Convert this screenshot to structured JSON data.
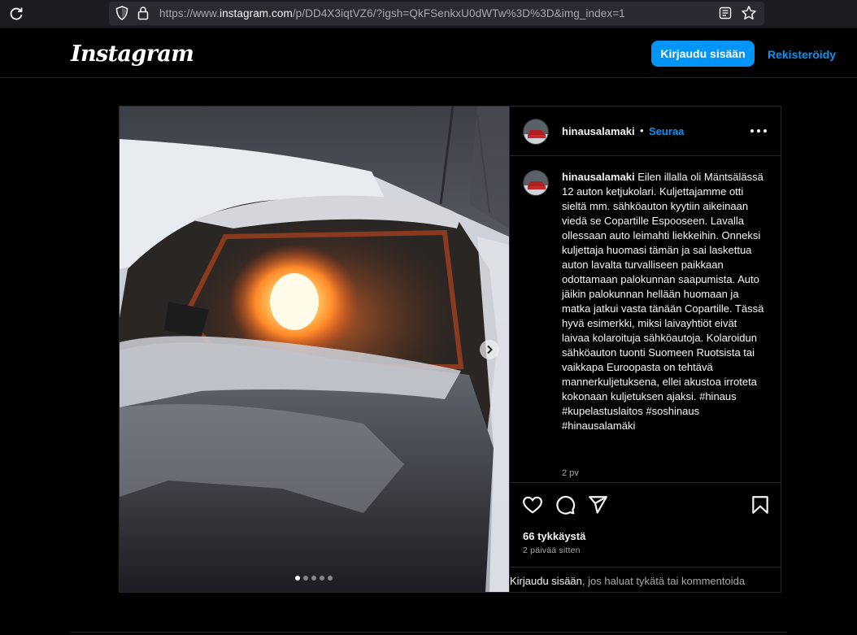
{
  "browser": {
    "url_prefix": "https://www.",
    "url_domain": "instagram.com",
    "url_path": "/p/DD4X3iqtVZ6/?igsh=QkFSenkxU0dWTw%3D%3D&img_index=1"
  },
  "header": {
    "logo": "Instagram",
    "login_label": "Kirjaudu sisään",
    "signup_label": "Rekisteröidy"
  },
  "post": {
    "username": "hinausalamaki",
    "separator": "•",
    "follow_label": "Seuraa",
    "caption_user": "hinausalamaki",
    "caption_text": "Eilen illalla oli Mäntsälässä 12 auton ketjukolari. Kuljettajamme otti sieltä mm. sähköauton kyytiin aikeinaan viedä se Copartille Espooseen. Lavalla ollessaan auto leimahti liekkeihin. Onneksi kuljettaja huomasi tämän ja sai laskettua auton lavalta turvalliseen paikkaan odottamaan palokunnan saapumista. Auto jäikin palokunnan hellään huomaan ja matka jatkui vasta tänään Copartille. Tässä hyvä esimerkki, miksi laivayhtiöt eivät laivaa kolaroituja sähköautoja. Kolaroidun sähköauton tuonti Suomeen Ruotsista tai vaikkapa Euroopasta on tehtävä mannerkuljetuksena, ellei akustoa irroteta kokonaan kuljetuksen ajaksi. #hinaus #kupelastuslaitos #soshinaus #hinausalamäki",
    "caption_time": "2 pv",
    "likes": "66 tykkäystä",
    "posted": "2 päivää sitten",
    "login_prompt_link": "Kirjaudu sisään",
    "login_prompt_rest": ", jos haluat tykätä tai kommentoida",
    "carousel_count": 5,
    "carousel_active": 1
  },
  "icons": [
    "reload-icon",
    "shield-icon",
    "lock-icon",
    "reader-view-icon",
    "bookmark-star-icon",
    "more-options-icon",
    "heart-icon",
    "comment-icon",
    "share-icon",
    "save-icon",
    "chevron-right-icon"
  ],
  "colors": {
    "accent": "#0095f6",
    "background": "#000000",
    "border": "#262626",
    "secondary_text": "#a8a8a8"
  }
}
